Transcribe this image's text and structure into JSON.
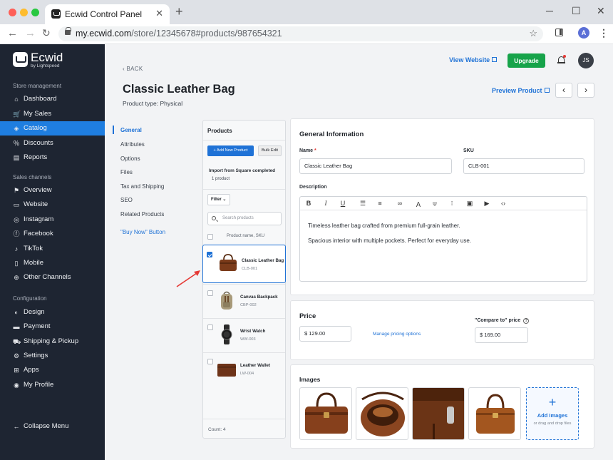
{
  "browser": {
    "tab_title": "Ecwid Control Panel",
    "url_domain": "my.ecwid.com",
    "url_path": "/store/12345678#products/987654321",
    "profile_initial": "A"
  },
  "sidebar": {
    "brand_name": "Ecwid",
    "brand_sub": "by Lightspeed",
    "section_store": "Store management",
    "store_items": [
      {
        "label": "Dashboard",
        "icon": "home-icon"
      },
      {
        "label": "My Sales",
        "icon": "cart-icon"
      },
      {
        "label": "Catalog",
        "icon": "tag-icon",
        "active": true
      },
      {
        "label": "Discounts",
        "icon": "discount-icon"
      },
      {
        "label": "Reports",
        "icon": "reports-icon"
      }
    ],
    "section_channels": "Sales channels",
    "channel_items": [
      {
        "label": "Overview",
        "icon": "overview-icon"
      },
      {
        "label": "Website",
        "icon": "website-icon"
      },
      {
        "label": "Instagram",
        "icon": "instagram-icon"
      },
      {
        "label": "Facebook",
        "icon": "facebook-icon"
      },
      {
        "label": "TikTok",
        "icon": "tiktok-icon"
      },
      {
        "label": "Mobile",
        "icon": "mobile-icon"
      },
      {
        "label": "Other Channels",
        "icon": "plus-icon"
      }
    ],
    "section_config": "Configuration",
    "config_items": [
      {
        "label": "Design",
        "icon": "palette-icon"
      },
      {
        "label": "Payment",
        "icon": "payment-icon"
      },
      {
        "label": "Shipping & Pickup",
        "icon": "truck-icon"
      },
      {
        "label": "Settings",
        "icon": "gear-icon"
      },
      {
        "label": "Apps",
        "icon": "apps-icon"
      },
      {
        "label": "My Profile",
        "icon": "profile-icon"
      }
    ],
    "collapse": "Collapse Menu"
  },
  "header": {
    "back": "BACK",
    "title": "Classic Leather Bag",
    "product_type": "Product type: Physical",
    "view_website": "View Website",
    "upgrade": "Upgrade",
    "user_initials": "JS",
    "preview": "Preview Product"
  },
  "product_menu": [
    "General",
    "Attributes",
    "Options",
    "Files",
    "Tax and Shipping",
    "SEO",
    "Related Products",
    "\"Buy Now\" Button"
  ],
  "products_panel": {
    "heading": "Products",
    "add_new": "+ Add New Product",
    "bulk_edit": "Bulk Edit",
    "import_title": "Import from Square completed",
    "import_count": "1 product",
    "filter": "Filter",
    "search_placeholder": "Search products",
    "column_header": "Product name, SKU",
    "items": [
      {
        "name": "Classic Leather Bag",
        "sku": "CLB-001",
        "selected": true
      },
      {
        "name": "Canvas Backpack",
        "sku": "CBP-002",
        "selected": false
      },
      {
        "name": "Wrist Watch",
        "sku": "WW-003",
        "selected": false
      },
      {
        "name": "Leather Wallet",
        "sku": "LW-004",
        "selected": false
      }
    ],
    "count": "Count: 4"
  },
  "general": {
    "title": "General Information",
    "name_label": "Name",
    "name_required": "*",
    "name_value": "Classic Leather Bag",
    "sku_label": "SKU",
    "sku_value": "CLB-001",
    "description_label": "Description",
    "description_lines": [
      "Timeless leather bag crafted from premium full-grain leather.",
      "Spacious interior with multiple pockets. Perfect for everyday use."
    ]
  },
  "price": {
    "title": "Price",
    "value": "$  129.00",
    "manage": "Manage pricing options",
    "compare_label": "\"Compare to\" price",
    "compare_value": "$  169.00"
  },
  "images": {
    "title": "Images",
    "add_label": "Add Images",
    "add_hint": "or drag and drop files"
  }
}
